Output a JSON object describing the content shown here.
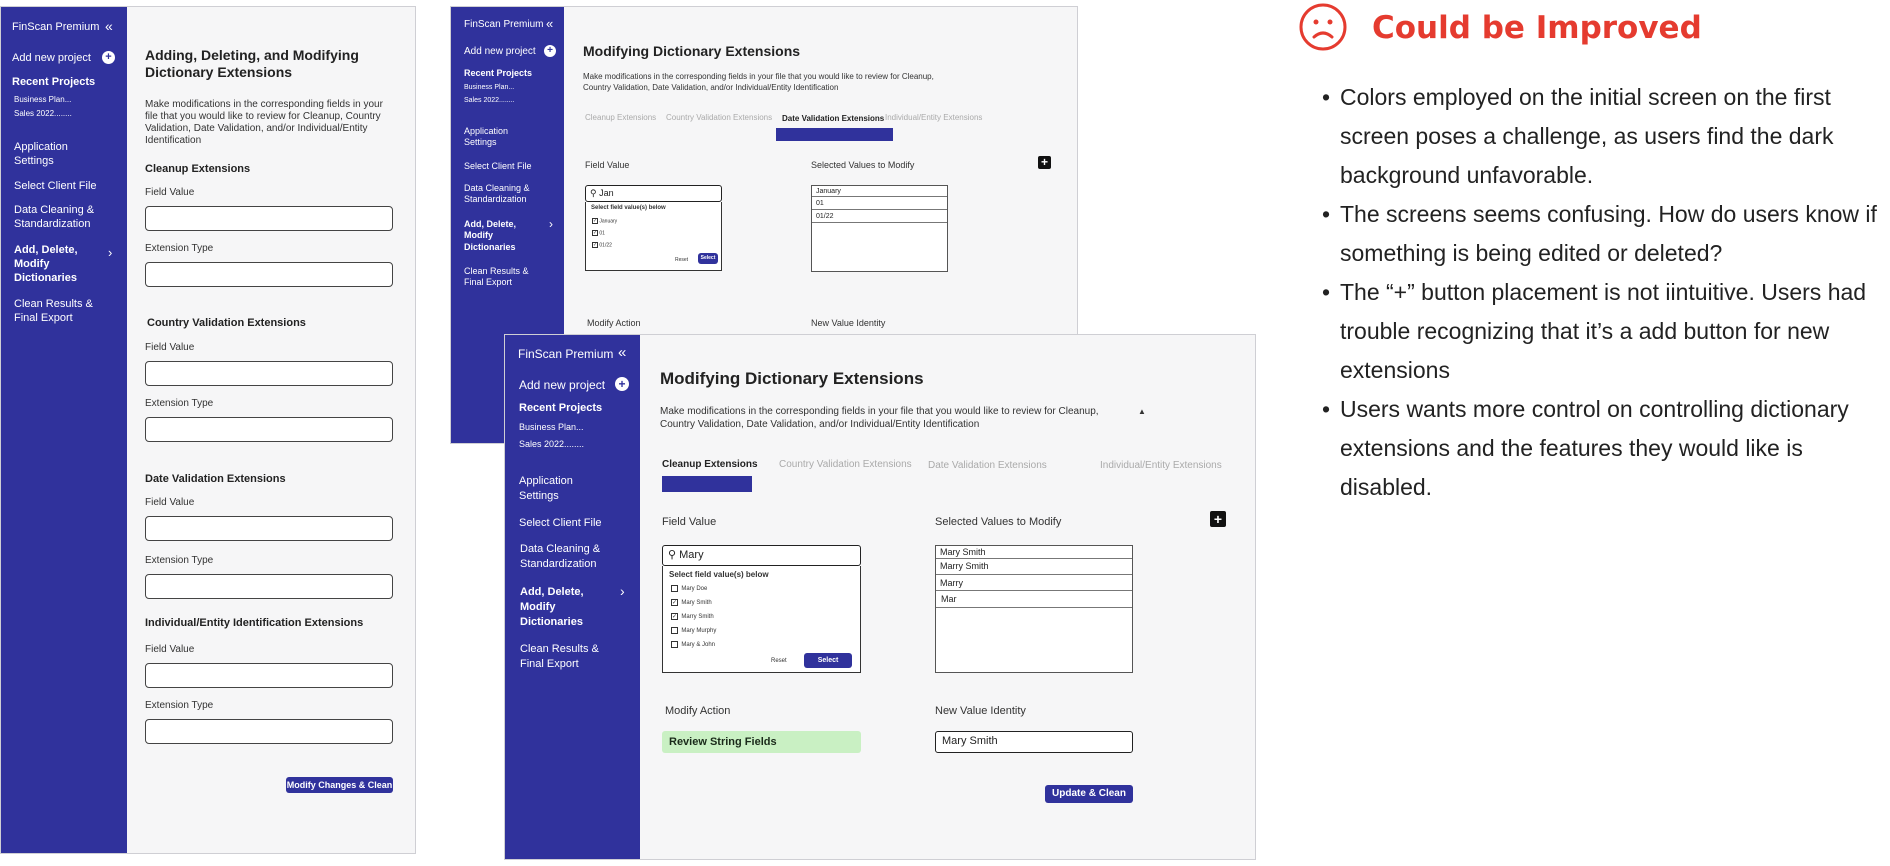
{
  "screen1": {
    "sidebar": {
      "brand": "FinScan Premium",
      "collapse_icon": "«",
      "add_project": "Add new project",
      "recent_title": "Recent Projects",
      "recent": [
        "Business Plan...",
        "Sales 2022........"
      ],
      "items": [
        "Application Settings",
        "Select Client File",
        "Data Cleaning & Standardization",
        "Add, Delete, Modify Dictionaries",
        "Clean Results & Final Export"
      ],
      "active_index": 3
    },
    "title": "Adding, Deleting, and Modifying Dictionary Extensions",
    "description": "Make modifications in the corresponding fields in your file that you would like to review for Cleanup, Country Validation, Date Validation, and/or Individual/Entity Identification",
    "sections": [
      {
        "heading": "Cleanup Extensions",
        "field_value_label": "Field Value",
        "extension_type_label": "Extension Type"
      },
      {
        "heading": "Country Validation Extensions",
        "field_value_label": "Field Value",
        "extension_type_label": "Extension Type"
      },
      {
        "heading": "Date Validation Extensions",
        "field_value_label": "Field Value",
        "extension_type_label": "Extension Type"
      },
      {
        "heading": "Individual/Entity Identification Extensions",
        "field_value_label": "Field Value",
        "extension_type_label": "Extension Type"
      }
    ],
    "submit_button": "Modify Changes & Clean"
  },
  "screen2": {
    "sidebar": {
      "brand": "FinScan Premium",
      "collapse_icon": "«",
      "add_project": "Add new project",
      "recent_title": "Recent Projects",
      "recent": [
        "Business Plan...",
        "Sales 2022........"
      ],
      "items": [
        "Application Settings",
        "Select Client File",
        "Data Cleaning & Standardization",
        "Add, Delete, Modify Dictionaries",
        "Clean Results & Final Export"
      ],
      "active_index": 3
    },
    "title": "Modifying Dictionary Extensions",
    "description": "Make modifications in the corresponding fields in your file that you would like to review for Cleanup, Country Validation, Date Validation, and/or Individual/Entity Identification",
    "tabs": [
      "Cleanup Extensions",
      "Country Validation Extensions",
      "Date Validation Extensions",
      "Individual/Entity Extensions"
    ],
    "active_tab": 2,
    "field_value_label": "Field Value",
    "selected_values_label": "Selected Values to Modify",
    "search_value": "Jan",
    "dropdown_title": "Select field value(s) below",
    "options": [
      {
        "label": "January",
        "checked": true
      },
      {
        "label": "01",
        "checked": true
      },
      {
        "label": "01/22",
        "checked": true
      }
    ],
    "reset_label": "Reset",
    "select_label": "Select",
    "selected_values": [
      "January",
      "01",
      "01/22"
    ],
    "modify_action_label": "Modify Action",
    "new_value_label": "New Value Identity",
    "plus_icon": "+"
  },
  "screen3": {
    "sidebar": {
      "brand": "FinScan Premium",
      "collapse_icon": "«",
      "add_project": "Add new project",
      "recent_title": "Recent Projects",
      "recent": [
        "Business Plan...",
        "Sales 2022........"
      ],
      "items": [
        "Application Settings",
        "Select Client File",
        "Data Cleaning & Standardization",
        "Add, Delete, Modify Dictionaries",
        "Clean Results & Final Export"
      ],
      "active_index": 3
    },
    "title": "Modifying Dictionary Extensions",
    "description": "Make modifications in the corresponding fields in your file that you would like to review for Cleanup, Country Validation, Date Validation, and/or Individual/Entity Identification",
    "tabs": [
      "Cleanup Extensions",
      "Country Validation Extensions",
      "Date Validation Extensions",
      "Individual/Entity Extensions"
    ],
    "active_tab": 0,
    "field_value_label": "Field Value",
    "selected_values_label": "Selected Values to Modify",
    "search_value": "Mary",
    "dropdown_title": "Select field value(s) below",
    "options": [
      {
        "label": "Mary Doe",
        "checked": false
      },
      {
        "label": "Mary Smith",
        "checked": true
      },
      {
        "label": "Marry Smith",
        "checked": true
      },
      {
        "label": "Mary Murphy",
        "checked": false
      },
      {
        "label": "Mary & John",
        "checked": false
      }
    ],
    "reset_label": "Reset",
    "select_label": "Select",
    "selected_values": [
      "Mary Smith",
      "Marry Smith",
      "Marry",
      "Mar"
    ],
    "modify_action_label": "Modify Action",
    "modify_action_value": "Review String Fields",
    "new_value_label": "New Value Identity",
    "new_value": "Mary Smith",
    "update_button": "Update & Clean",
    "plus_icon": "+",
    "caret_icon": "▲"
  },
  "critique": {
    "title": "Could be Improved",
    "icon": "sad-face-icon",
    "color": "#e53b2f",
    "points": [
      "Colors employed on the initial screen on the first screen poses a challenge, as users find the dark background unfavorable.",
      "The screens seems confusing. How do users know if something is being edited or deleted?",
      "The “+” button placement is not iintuitive. Users had trouble recognizing that it’s a add button for new extensions",
      "Users wants more control on controlling dictionary extensions and the features they would like is disabled."
    ]
  }
}
